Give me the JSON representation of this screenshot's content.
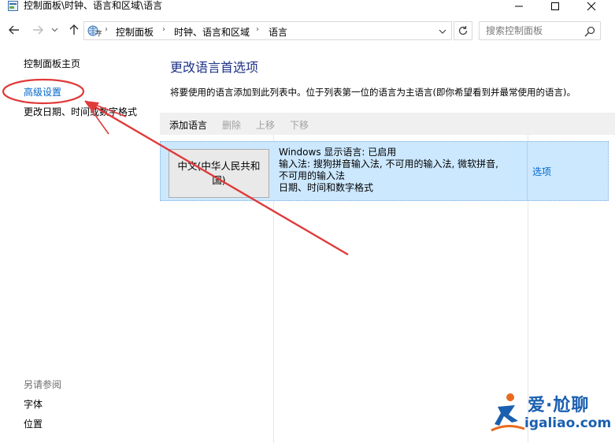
{
  "window": {
    "title": "控制面板\\时钟、语言和区域\\语言"
  },
  "address_bar": {
    "breadcrumbs": [
      "控制面板",
      "时钟、语言和区域",
      "语言"
    ],
    "separator": "›"
  },
  "search": {
    "placeholder": "搜索控制面板"
  },
  "left_pane": {
    "home": "控制面板主页",
    "advanced": "高级设置",
    "date_time": "更改日期、时间或数字格式",
    "see_also": "另请参阅",
    "fonts": "字体",
    "location": "位置"
  },
  "main": {
    "title": "更改语言首选项",
    "description": "将要使用的语言添加到此列表中。位于列表第一位的语言为主语言(即你希望看到并最常使用的语言)。",
    "toolbar": {
      "add": "添加语言",
      "remove": "删除",
      "move_up": "上移",
      "move_down": "下移"
    },
    "languages": [
      {
        "name": "中文(中华人民共和国)",
        "details": [
          "Windows 显示语言: 已启用",
          "输入法: 搜狗拼音输入法, 不可用的输入法, 微软拼音,",
          "不可用的输入法",
          "日期、时间和数字格式"
        ],
        "options": "选项"
      }
    ]
  },
  "watermark": {
    "brand": "爱·尬聊",
    "url": "igaliao.com"
  },
  "colors": {
    "link": "#0066cc",
    "title": "#1e3287",
    "selection": "#cce8ff",
    "annotation": "#e03a3a"
  }
}
